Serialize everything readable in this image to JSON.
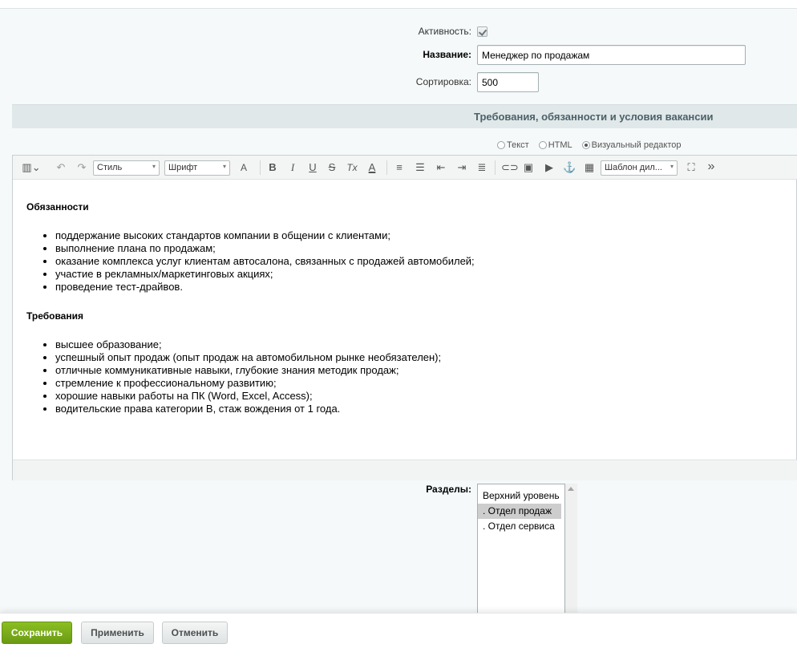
{
  "form": {
    "activity_label": "Активность:",
    "activity_checked": true,
    "name_label": "Название:",
    "name_value": "Менеджер по продажам",
    "sort_label": "Сортировка:",
    "sort_value": "500"
  },
  "section": {
    "title": "Требования, обязанности и условия вакансии"
  },
  "editor": {
    "modes": [
      {
        "label": "Текст",
        "selected": false
      },
      {
        "label": "HTML",
        "selected": false
      },
      {
        "label": "Визуальный редактор",
        "selected": true
      }
    ],
    "toolbar": {
      "style_select": "Стиль",
      "font_select": "Шрифт",
      "font_size": "A",
      "bold": "B",
      "italic": "I",
      "underline": "U",
      "strike": "S",
      "clear_format": "Tx",
      "font_color": "A",
      "template_select": "Шаблон дил...",
      "more": "»"
    },
    "content": {
      "heading1": "Обязанности",
      "list1": [
        "поддержание высоких стандартов компании в общении с клиентами;",
        "выполнение плана по продажам;",
        "оказание комплекса услуг клиентам автосалона, связанных с продажей автомобилей;",
        "участие в рекламных/маркетинговых акциях;",
        "проведение тест-драйвов."
      ],
      "heading2": "Требования",
      "list2": [
        "высшее образование;",
        "успешный опыт продаж (опыт продаж на автомобильном рынке необязателен);",
        "отличные коммуникативные навыки, глубокие знания методик продаж;",
        "стремление к профессиональному развитию;",
        "хорошие навыки работы на ПК (Word, Excel, Access);",
        "водительские права категории В, стаж вождения от 1 года."
      ]
    }
  },
  "sections_field": {
    "label": "Разделы:",
    "options": [
      {
        "label": "Верхний уровень",
        "selected": false
      },
      {
        "label": ". Отдел продаж",
        "selected": true
      },
      {
        "label": ". Отдел сервиса",
        "selected": false
      }
    ]
  },
  "buttons": {
    "save": "Сохранить",
    "apply": "Применить",
    "cancel": "Отменить"
  }
}
